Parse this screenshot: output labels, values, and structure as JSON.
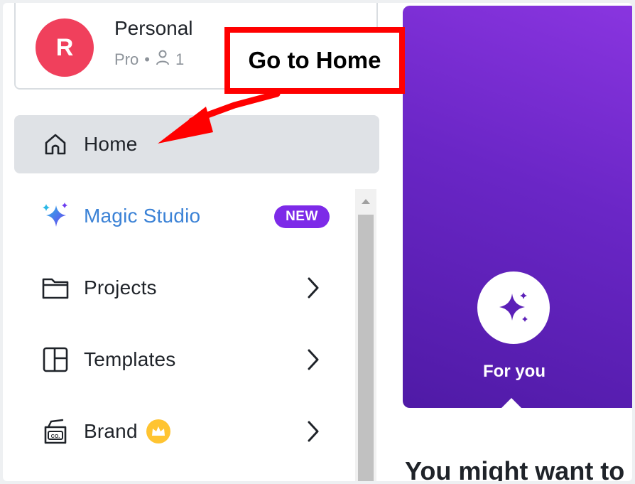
{
  "account": {
    "avatar_letter": "R",
    "name": "Personal",
    "plan": "Pro",
    "separator": "•",
    "members_count": "1",
    "avatar_color": "#f0405c"
  },
  "nav": {
    "home": {
      "label": "Home",
      "icon": "home-icon"
    },
    "magic_studio": {
      "label": "Magic Studio",
      "badge": "NEW",
      "icon": "sparkle-icon"
    },
    "projects": {
      "label": "Projects",
      "icon": "folder-icon"
    },
    "templates": {
      "label": "Templates",
      "icon": "templates-icon"
    },
    "brand": {
      "label": "Brand",
      "icon": "brand-kit-icon"
    }
  },
  "main": {
    "hero_tab_label": "For you",
    "section_heading": "You might want to"
  },
  "annotation": {
    "callout_text": "Go to Home",
    "color": "#ff0000"
  },
  "colors": {
    "accent_purple": "#7d2ae8",
    "magic_blue": "#3b82d6",
    "active_nav_bg": "#dfe2e6",
    "crown_gold": "#ffc431"
  }
}
